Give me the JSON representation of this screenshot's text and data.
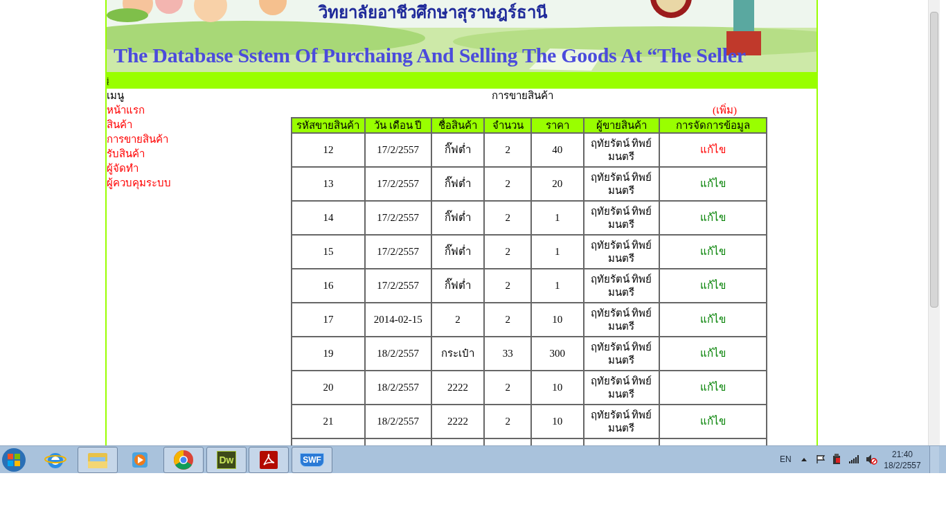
{
  "banner": {
    "college_name": "วิทยาลัยอาชีวศึกษาสุราษฎร์ธานี",
    "system_title": "The Database Sstem Of Purchaing And Selling The Goods At “The Seller"
  },
  "nav_bar": {
    "text": "į"
  },
  "menu": {
    "heading": "เมนู",
    "items": [
      "หน้าแรก",
      "สินค้า",
      "การขายสินค้า",
      "รับสินค้า",
      "ผู้จัดทำ",
      "ผู้ควบคุมระบบ"
    ]
  },
  "page_title": "การขายสินค้า",
  "add_link": "(เพิ่ม)",
  "table": {
    "columns": [
      "รหัสขายสินค้า",
      "วัน เดือน ปี",
      "ชื่อสินค้า",
      "จำนวน",
      "ราคา",
      "ผู้ขายสินค้า",
      "การจัดการข้อมูล"
    ],
    "rows": [
      {
        "cells": [
          "12",
          "17/2/2557",
          "กิ๊ฟต่ำ",
          "2",
          "40",
          "ฤทัยรัตน์ ทิพย์มนตรี"
        ],
        "action": "แก้ไข",
        "color": "#ff0000"
      },
      {
        "cells": [
          "13",
          "17/2/2557",
          "กิ๊ฟต่ำ",
          "2",
          "20",
          "ฤทัยรัตน์ ทิพย์มนตรี"
        ],
        "action": "แก้ไข",
        "color": "#008000"
      },
      {
        "cells": [
          "14",
          "17/2/2557",
          "กิ๊ฟต่ำ",
          "2",
          "1",
          "ฤทัยรัตน์ ทิพย์มนตรี"
        ],
        "action": "แก้ไข",
        "color": "#008000"
      },
      {
        "cells": [
          "15",
          "17/2/2557",
          "กิ๊ฟต่ำ",
          "2",
          "1",
          "ฤทัยรัตน์ ทิพย์มนตรี"
        ],
        "action": "แก้ไข",
        "color": "#008000"
      },
      {
        "cells": [
          "16",
          "17/2/2557",
          "กิ๊ฟต่ำ",
          "2",
          "1",
          "ฤทัยรัตน์ ทิพย์มนตรี"
        ],
        "action": "แก้ไข",
        "color": "#008000"
      },
      {
        "cells": [
          "17",
          "2014-02-15",
          "2",
          "2",
          "10",
          "ฤทัยรัตน์ ทิพย์มนตรี"
        ],
        "action": "แก้ไข",
        "color": "#008000"
      },
      {
        "cells": [
          "19",
          "18/2/2557",
          "กระเป๋า",
          "33",
          "300",
          "ฤทัยรัตน์ ทิพย์มนตรี"
        ],
        "action": "แก้ไข",
        "color": "#008000"
      },
      {
        "cells": [
          "20",
          "18/2/2557",
          "2222",
          "2",
          "10",
          "ฤทัยรัตน์ ทิพย์มนตรี"
        ],
        "action": "แก้ไข",
        "color": "#008000"
      },
      {
        "cells": [
          "21",
          "18/2/2557",
          "2222",
          "2",
          "10",
          "ฤทัยรัตน์ ทิพย์มนตรี"
        ],
        "action": "แก้ไข",
        "color": "#008000"
      }
    ]
  },
  "taskbar": {
    "apps": [
      {
        "kind": "start",
        "selected": false
      },
      {
        "kind": "browser_e",
        "selected": false
      },
      {
        "kind": "folder",
        "selected": true
      },
      {
        "kind": "media",
        "selected": false
      },
      {
        "kind": "chrome",
        "selected": true
      },
      {
        "kind": "badge",
        "label": "Dw",
        "selected": true
      },
      {
        "kind": "pdf",
        "selected": true
      },
      {
        "kind": "swf",
        "label": "SWF",
        "selected": true
      }
    ],
    "language": "EN",
    "time": "21:40",
    "date": "18/2/2557"
  }
}
